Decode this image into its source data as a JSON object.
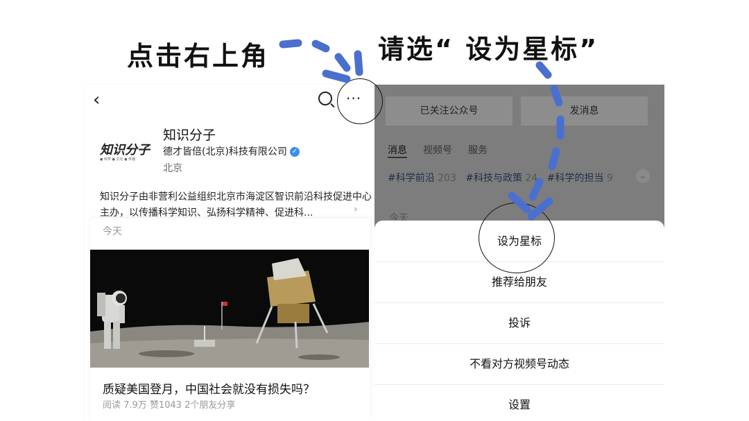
{
  "instructions": {
    "left_caption": "点击右上角",
    "right_caption": "请选“ 设为星标”"
  },
  "profile": {
    "logo_text": "知识分子",
    "logo_sub": "● 科学 ● 文化 ● 传播",
    "name": "知识分子",
    "company": "德才皆倍(北京)科技有限公司",
    "verified_mark": "✓",
    "city": "北京",
    "description": "知识分子由非营利公益组织北京市海淀区智识前沿科技促进中心主办，以传播科学知识、弘扬科学精神、促进科...",
    "icons": {
      "back": "back-chevron-icon",
      "search": "search-icon",
      "more": "more-dots-icon",
      "expand": "chevron-right-icon"
    }
  },
  "feed": {
    "date_label": "今天",
    "article_title": "质疑美国登月，中国社会就没有损失吗？",
    "article_meta": "阅读 7.9万  赞1043  2个朋友分享"
  },
  "background_page": {
    "followed_button": "已关注公众号",
    "message_button": "发消息",
    "tabs": [
      "消息",
      "视频号",
      "服务"
    ],
    "tags": [
      {
        "name": "#科学前沿",
        "count": "203"
      },
      {
        "name": "#科技与政策",
        "count": "24"
      },
      {
        "name": "#科学的担当",
        "count": "9"
      }
    ],
    "today_label": "今天"
  },
  "action_sheet": {
    "items": [
      "设为星标",
      "推荐给朋友",
      "投诉",
      "不看对方视频号动态",
      "设置"
    ]
  },
  "colors": {
    "arrow": "#4a6fcf",
    "overlay": "#7d7d7d",
    "verified": "#3b8fe8"
  }
}
